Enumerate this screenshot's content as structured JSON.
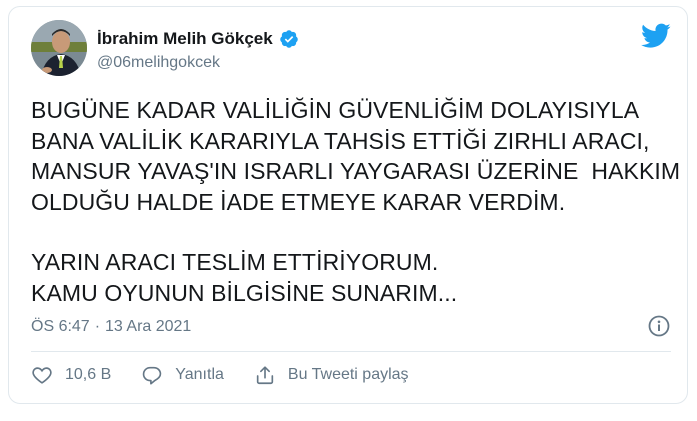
{
  "author": {
    "display_name": "İbrahim Melih Gökçek",
    "handle": "@06melihgokcek",
    "verified": true
  },
  "tweet": {
    "lines_paragraph_1": [
      "BUGÜNE KADAR VALİLİĞİN GÜVENLİĞİM DOLAYISIYLA",
      "BANA VALİLİK KARARIYLA TAHSİS ETTİĞİ ZIRHLI ARACI,",
      "MANSUR YAVAŞ'IN ISRARLI YAYGARASI ÜZERİNE  HAKKIM",
      "OLDUĞU HALDE İADE ETMEYE KARAR VERDİM."
    ],
    "lines_paragraph_2": [
      "YARIN ARACI TESLİM ETTİRİYORUM.",
      "KAMU OYUNUN BİLGİSİNE SUNARIM..."
    ]
  },
  "meta": {
    "time": "ÖS 6:47",
    "separator": "·",
    "date": "13 Ara 2021"
  },
  "actions": {
    "like_count": "10,6 B",
    "reply_label": "Yanıtla",
    "share_label": "Bu Tweeti paylaş"
  },
  "icons": {
    "brand": "twitter-bird-icon",
    "verified": "verified-badge-icon",
    "info": "info-icon",
    "like": "heart-icon",
    "reply": "reply-bubble-icon",
    "share": "share-icon"
  },
  "colors": {
    "twitter_blue": "#1da1f2",
    "text": "#14171a",
    "muted": "#657786",
    "border": "#e1e8ed"
  }
}
